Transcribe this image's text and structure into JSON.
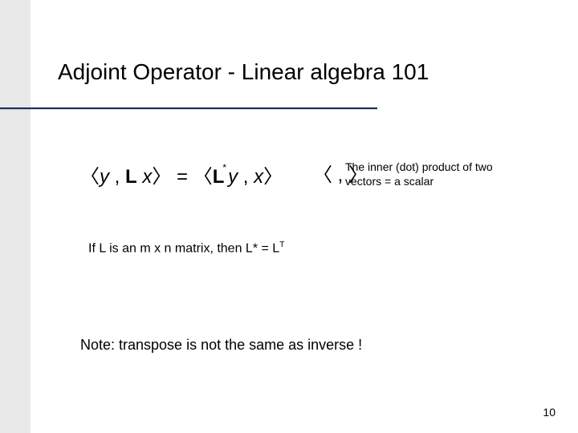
{
  "slide": {
    "title": "Adjoint Operator   - Linear algebra 101",
    "equation": {
      "lhs_open": "〈",
      "lhs_y": "y",
      "lhs_sep": " , ",
      "lhs_L": "L",
      "lhs_x": " x",
      "lhs_close": "〉",
      "eq": " = ",
      "rhs_open": "〈",
      "rhs_L": "L",
      "rhs_star": "*",
      "rhs_y": "y",
      "rhs_sep": " , ",
      "rhs_x": "x",
      "rhs_close": "〉"
    },
    "inner_symbol": "〈 , 〉",
    "inner_note": "The inner (dot) product of two vectors = a scalar",
    "statement": {
      "prefix": "If L is an  m x n  matrix, then L* = L",
      "sup": "T"
    },
    "note": "Note:  transpose is not the same as inverse !",
    "page_number": "10"
  }
}
